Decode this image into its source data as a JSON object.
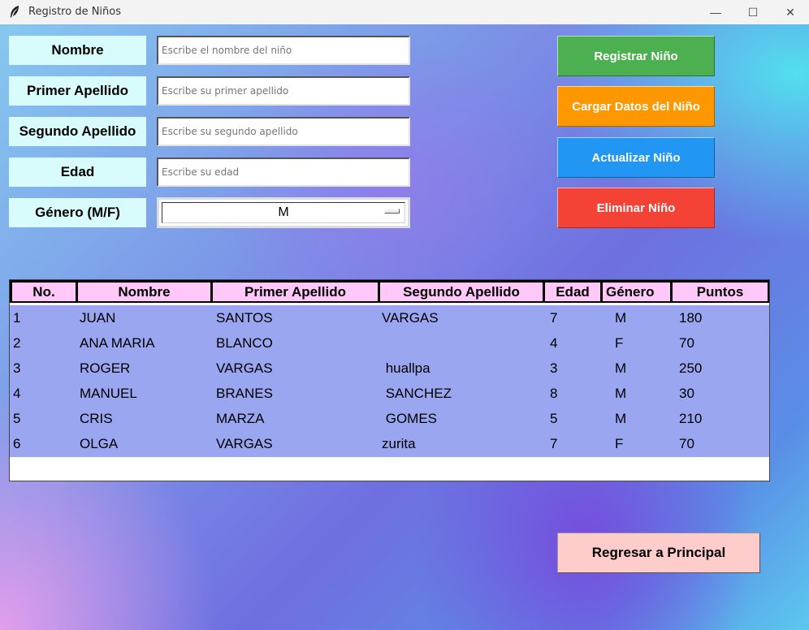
{
  "window": {
    "title": "Registro de Niños",
    "minimize": "—",
    "maximize": "☐",
    "close": "✕"
  },
  "form": {
    "nombre": {
      "label": "Nombre",
      "placeholder": "Escribe el nombre del niño"
    },
    "primer_apellido": {
      "label": "Primer Apellido",
      "placeholder": "Escribe su primer apellido"
    },
    "segundo_apellido": {
      "label": "Segundo Apellido",
      "placeholder": "Escribe su segundo apellido"
    },
    "edad": {
      "label": "Edad",
      "placeholder": "Escribe su edad"
    },
    "genero": {
      "label": "Género (M/F)",
      "value": "M"
    }
  },
  "actions": [
    {
      "label": "Registrar Niño",
      "color": "#4caf50"
    },
    {
      "label": "Cargar Datos del Niño",
      "color": "#ff9800"
    },
    {
      "label": "Actualizar Niño",
      "color": "#2196f3"
    },
    {
      "label": "Eliminar Niño",
      "color": "#f44336"
    }
  ],
  "table": {
    "columns": [
      "No.",
      "Nombre",
      "Primer Apellido",
      "Segundo Apellido",
      "Edad",
      "Género",
      "Puntos"
    ],
    "rows": [
      [
        "1",
        "JUAN",
        "SANTOS",
        "VARGAS",
        "7",
        "M",
        "180"
      ],
      [
        "2",
        "ANA MARIA",
        "BLANCO",
        "",
        "4",
        "F",
        "70"
      ],
      [
        "3",
        "ROGER",
        "VARGAS",
        " huallpa",
        "3",
        "M",
        "250"
      ],
      [
        "4",
        "MANUEL",
        "BRANES",
        " SANCHEZ",
        "8",
        "M",
        "30"
      ],
      [
        "5",
        "CRIS",
        "MARZA",
        " GOMES",
        "5",
        "M",
        "210"
      ],
      [
        "6",
        "OLGA",
        "VARGAS",
        "zurita",
        "7",
        "F",
        "70"
      ]
    ]
  },
  "back_button": {
    "label": "Regresar a Principal"
  }
}
